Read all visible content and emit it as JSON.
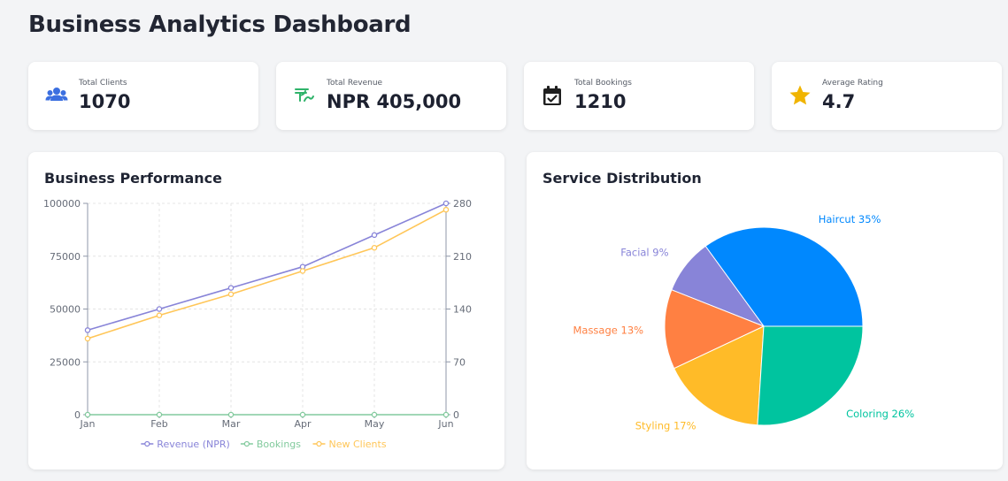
{
  "header": {
    "title": "Business Analytics Dashboard"
  },
  "stats": [
    {
      "label": "Total Clients",
      "value": "1070",
      "icon": "users-icon",
      "color": "#3b6fe0"
    },
    {
      "label": "Total Revenue",
      "value": "NPR 405,000",
      "icon": "rupee-icon",
      "color": "#2fb36a"
    },
    {
      "label": "Total Bookings",
      "value": "1210",
      "icon": "calendar-check-icon",
      "color": "#1f1f1f"
    },
    {
      "label": "Average Rating",
      "value": "4.7",
      "icon": "star-icon",
      "color": "#f0b400"
    }
  ],
  "performance": {
    "title": "Business Performance",
    "chart_data": {
      "type": "line",
      "categories": [
        "Jan",
        "Feb",
        "Mar",
        "Apr",
        "May",
        "Jun"
      ],
      "y_left": {
        "ylim": [
          0,
          100000
        ],
        "ticks": [
          "0",
          "25000",
          "50000",
          "75000",
          "100000"
        ]
      },
      "y_right": {
        "ylim": [
          0,
          280
        ],
        "ticks": [
          "0",
          "70",
          "140",
          "210",
          "280"
        ]
      },
      "grid": true,
      "legend_position": "bottom",
      "series": [
        {
          "name": "Revenue (NPR)",
          "axis": "left",
          "color": "#8884d8",
          "values": [
            40000,
            50000,
            60000,
            70000,
            85000,
            100000
          ]
        },
        {
          "name": "Bookings",
          "axis": "left",
          "color": "#82ca9d",
          "values": [
            0,
            0,
            0,
            0,
            0,
            0
          ]
        },
        {
          "name": "New Clients",
          "axis": "left",
          "color": "#ffc658",
          "values": [
            36000,
            47000,
            57000,
            68000,
            79000,
            97000
          ]
        }
      ]
    }
  },
  "distribution": {
    "title": "Service Distribution",
    "chart_data": {
      "type": "pie",
      "slices": [
        {
          "label": "Haircut 35%",
          "value": 35,
          "color": "#0088fe"
        },
        {
          "label": "Facial 9%",
          "value": 9,
          "color": "#8884d8"
        },
        {
          "label": "Massage 13%",
          "value": 13,
          "color": "#ff8042"
        },
        {
          "label": "Styling 17%",
          "value": 17,
          "color": "#ffbb28"
        },
        {
          "label": "Coloring 26%",
          "value": 26,
          "color": "#00c49f"
        }
      ]
    }
  }
}
